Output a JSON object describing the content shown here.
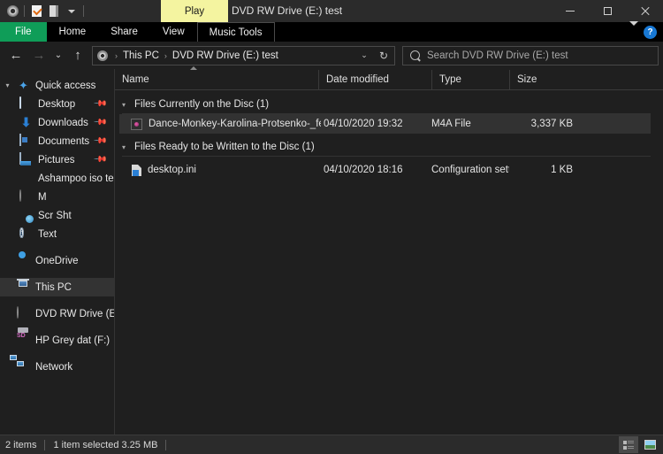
{
  "window": {
    "title": "DVD RW Drive (E:) test",
    "play_tab_label": "Play",
    "quick_access_icons": [
      "disc-icon",
      "properties-icon",
      "rename-icon",
      "customize-chevron-icon"
    ],
    "controls": {
      "minimize": "minimize-icon",
      "maximize": "maximize-icon",
      "close": "close-icon"
    }
  },
  "ribbon": {
    "tabs": [
      {
        "label": "File",
        "type": "file",
        "active": true
      },
      {
        "label": "Home",
        "type": "normal",
        "active": false
      },
      {
        "label": "Share",
        "type": "normal",
        "active": false
      },
      {
        "label": "View",
        "type": "normal",
        "active": false
      },
      {
        "label": "Music Tools",
        "type": "contextual",
        "active": false
      }
    ],
    "expand_label": "chevron-down-icon",
    "help_label": "?"
  },
  "nav": {
    "back": "←",
    "forward": "→",
    "recent": "⌄",
    "up": "↑",
    "breadcrumbs": [
      {
        "label": "This PC"
      },
      {
        "label": "DVD RW Drive (E:) test"
      }
    ],
    "separator": "›",
    "dropdown": "⌄",
    "refresh": "↻"
  },
  "search": {
    "placeholder": "Search DVD RW Drive (E:) test",
    "value": ""
  },
  "sidebar": {
    "items": [
      {
        "label": "Quick access",
        "icon": "star-icon",
        "level": "root",
        "expanded": true,
        "pinned": false,
        "selected": false
      },
      {
        "label": "Desktop",
        "icon": "desktop-icon",
        "level": "child",
        "pinned": true,
        "selected": false
      },
      {
        "label": "Downloads",
        "icon": "download-icon",
        "level": "child",
        "pinned": true,
        "selected": false
      },
      {
        "label": "Documents",
        "icon": "documents-icon",
        "level": "child",
        "pinned": true,
        "selected": false
      },
      {
        "label": "Pictures",
        "icon": "pictures-icon",
        "level": "child",
        "pinned": true,
        "selected": false
      },
      {
        "label": "Ashampoo iso test",
        "icon": "folder-icon",
        "level": "child",
        "pinned": false,
        "selected": false
      },
      {
        "label": "M",
        "icon": "disc-drive-icon",
        "level": "child",
        "pinned": false,
        "selected": false
      },
      {
        "label": "Scr Sht",
        "icon": "folder-shared-icon",
        "level": "child",
        "pinned": false,
        "selected": false
      },
      {
        "label": "Text",
        "icon": "info-icon",
        "level": "child",
        "pinned": false,
        "selected": false
      },
      {
        "label": "OneDrive",
        "icon": "onedrive-icon",
        "level": "root",
        "expanded": false,
        "pinned": false,
        "selected": false
      },
      {
        "label": "This PC",
        "icon": "this-pc-icon",
        "level": "root",
        "expanded": false,
        "pinned": false,
        "selected": true
      },
      {
        "label": "DVD RW Drive (E:) te",
        "icon": "dvd-drive-icon",
        "level": "root",
        "expanded": false,
        "pinned": false,
        "selected": false
      },
      {
        "label": "HP Grey dat (F:)",
        "icon": "sd-card-icon",
        "level": "root",
        "expanded": false,
        "pinned": false,
        "selected": false
      },
      {
        "label": "Network",
        "icon": "network-icon",
        "level": "root",
        "expanded": false,
        "pinned": false,
        "selected": false
      }
    ]
  },
  "filelist": {
    "columns": [
      {
        "label": "Name",
        "sorted": "asc"
      },
      {
        "label": "Date modified",
        "sorted": ""
      },
      {
        "label": "Type",
        "sorted": ""
      },
      {
        "label": "Size",
        "sorted": ""
      }
    ],
    "groups": [
      {
        "header": "Files Currently on the Disc (1)",
        "expanded": true,
        "rows": [
          {
            "name": "Dance-Monkey-Karolina-Protsenko-_feat....",
            "date": "04/10/2020 19:32",
            "type": "M4A File",
            "size": "3,337 KB",
            "icon": "m4a-file-icon",
            "selected": true
          }
        ]
      },
      {
        "header": "Files Ready to be Written to the Disc (1)",
        "expanded": true,
        "rows": [
          {
            "name": "desktop.ini",
            "date": "04/10/2020 18:16",
            "type": "Configuration setti...",
            "size": "1 KB",
            "icon": "ini-file-icon",
            "selected": false
          }
        ]
      }
    ]
  },
  "statusbar": {
    "item_count": "2 items",
    "selection": "1 item selected  3.25 MB",
    "view_details": "details-view-icon",
    "view_large_icons": "large-icons-view-icon"
  },
  "colors": {
    "file_tab": "#0f9d58",
    "play_tab": "#f4f4a0",
    "help_badge": "#1878d4",
    "window_bg": "#1f1f1f",
    "titlebar_bg": "#2b2b2b",
    "selection_bg": "#323232"
  }
}
